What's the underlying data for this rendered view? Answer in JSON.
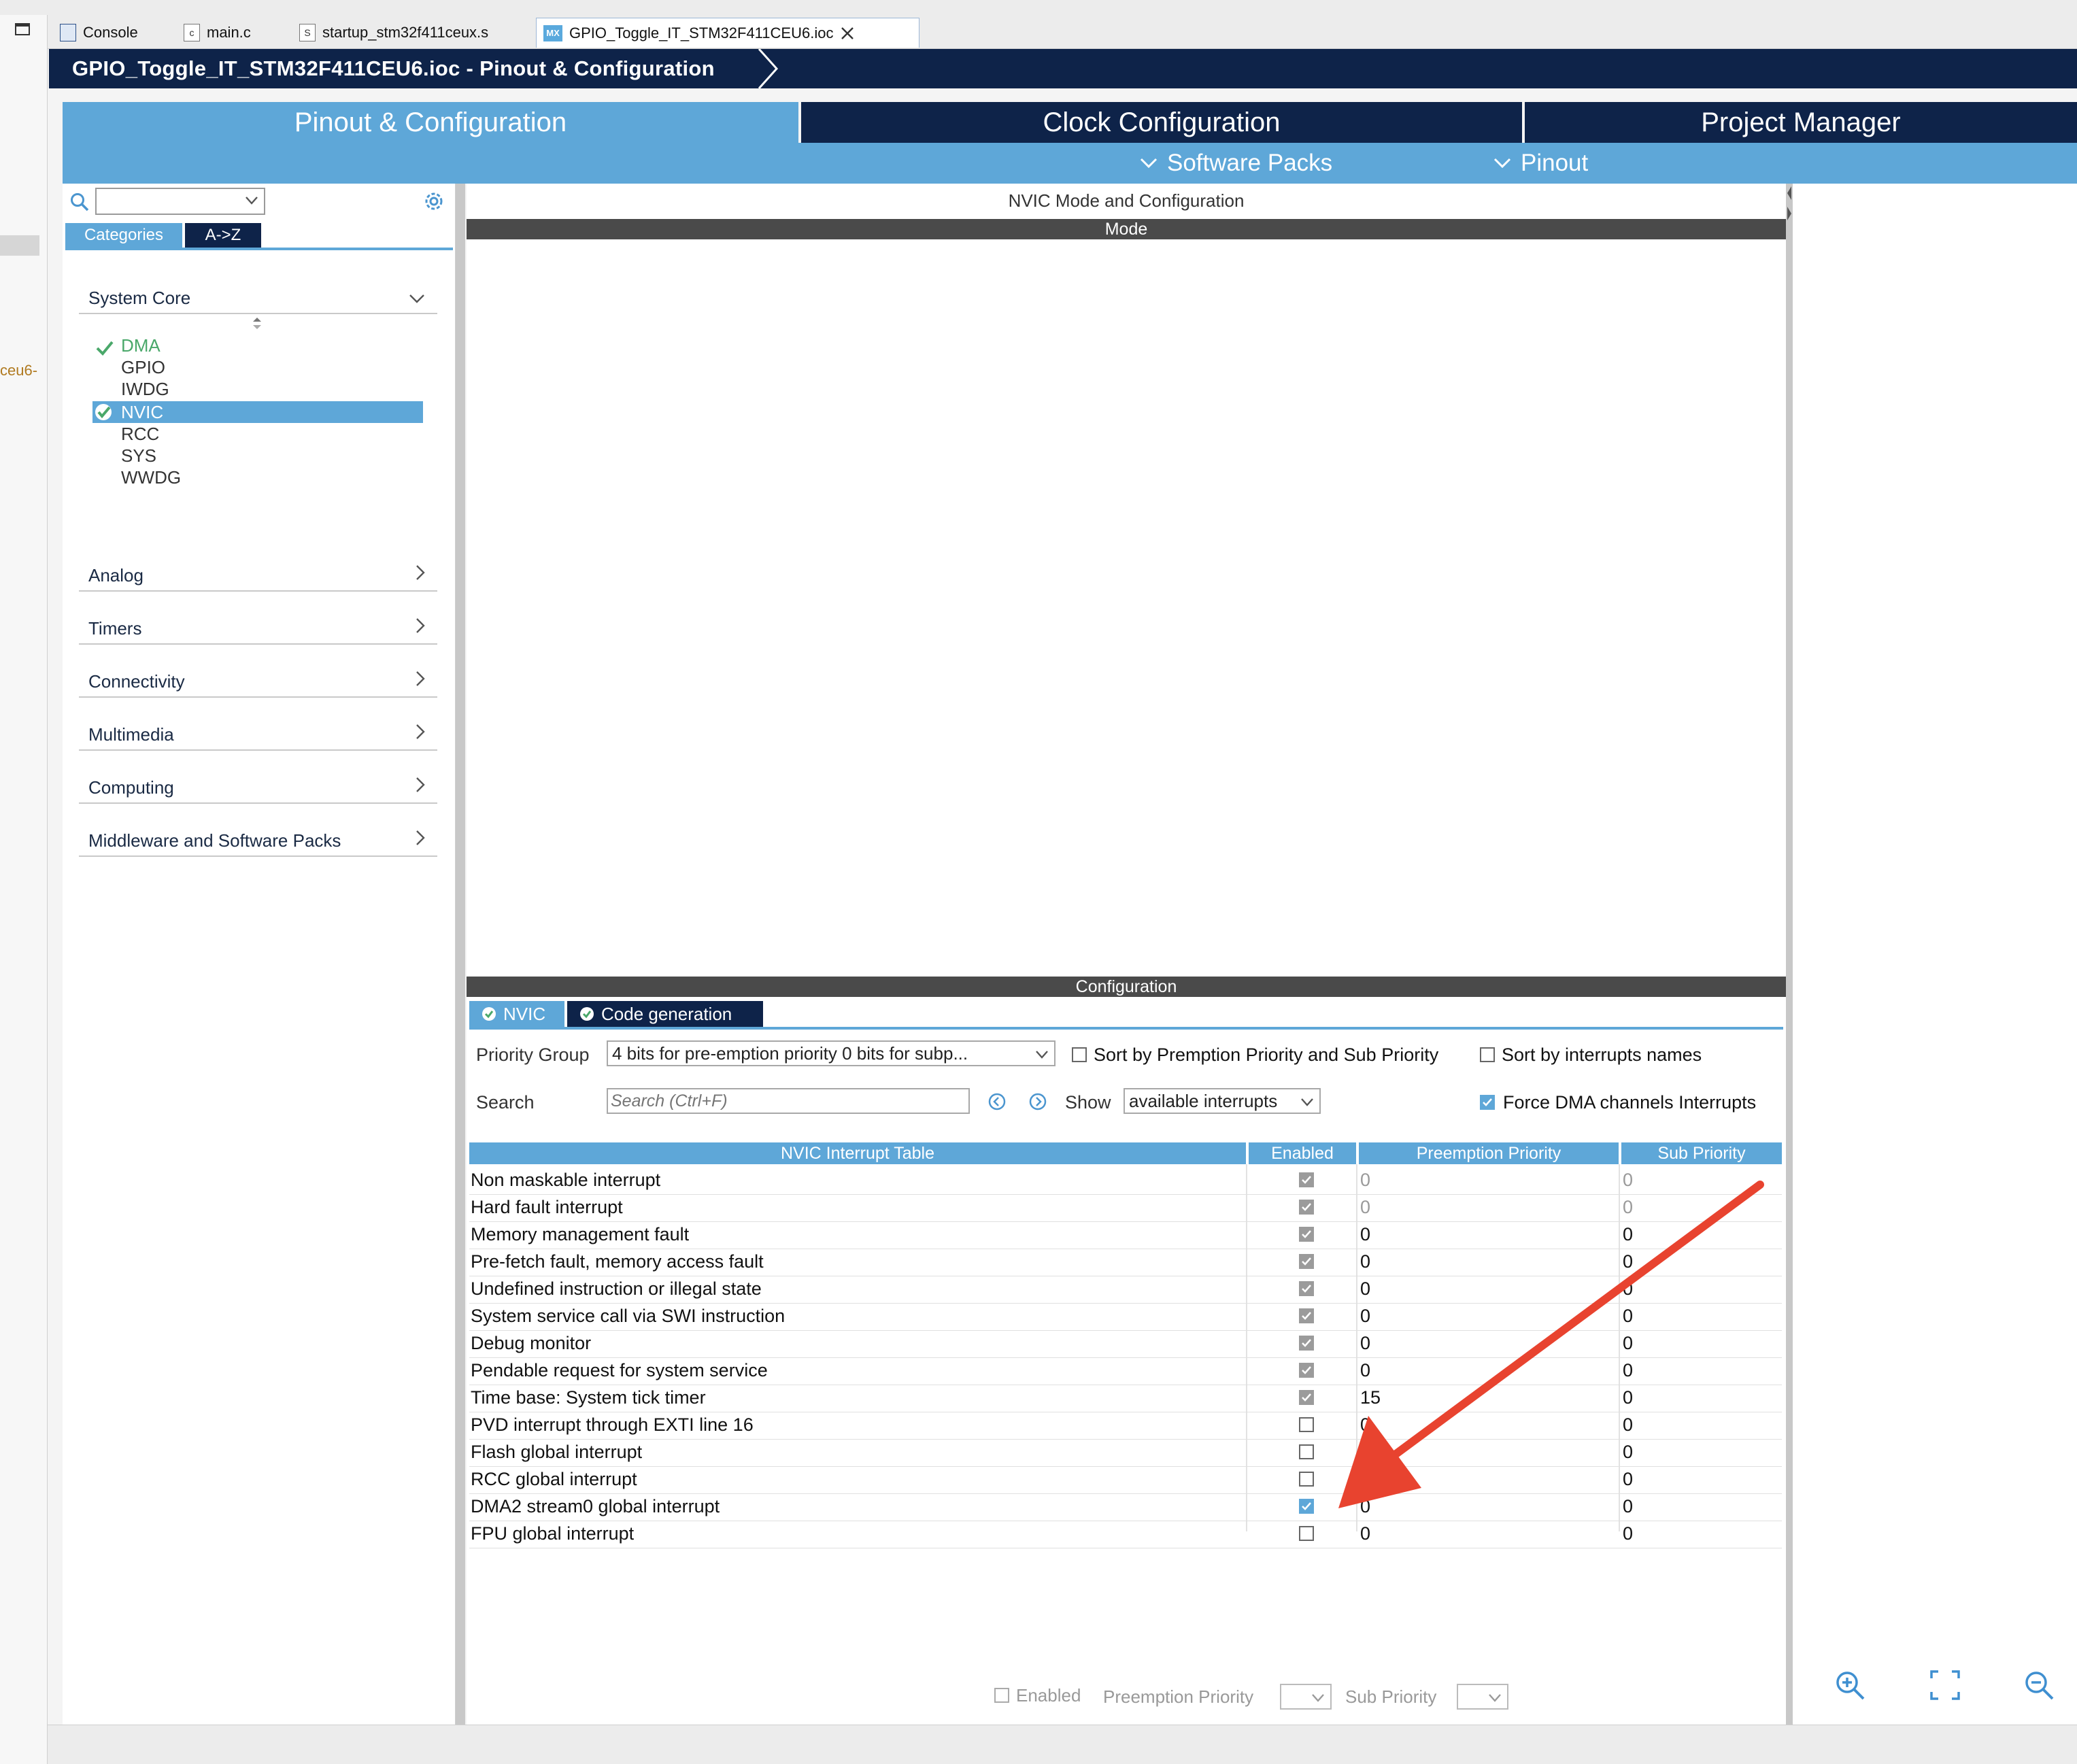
{
  "editor_tabs": [
    {
      "label": "Console",
      "icon": "console-icon"
    },
    {
      "label": "main.c",
      "icon": "c-file-icon",
      "icon_text": "c"
    },
    {
      "label": "startup_stm32f411ceux.s",
      "icon": "asm-file-icon",
      "icon_text": "S"
    },
    {
      "label": "GPIO_Toggle_IT_STM32F411CEU6.ioc",
      "icon": "mx-file-icon",
      "icon_text": "MX"
    }
  ],
  "left_margin_fragment": "ceu6-",
  "title": "GPIO_Toggle_IT_STM32F411CEU6.ioc - Pinout & Configuration",
  "main_tabs": [
    {
      "label": "Pinout & Configuration"
    },
    {
      "label": "Clock Configuration"
    },
    {
      "label": "Project Manager"
    }
  ],
  "sub_menu": [
    {
      "label": "Software Packs"
    },
    {
      "label": "Pinout"
    }
  ],
  "left_panel": {
    "search_value": "",
    "view_tabs": [
      "Categories",
      "A->Z"
    ],
    "categories": [
      {
        "label": "System Core",
        "expanded": true
      },
      {
        "label": "Analog"
      },
      {
        "label": "Timers"
      },
      {
        "label": "Connectivity"
      },
      {
        "label": "Multimedia"
      },
      {
        "label": "Computing"
      },
      {
        "label": "Middleware and Software Packs"
      }
    ],
    "system_core_items": [
      "DMA",
      "GPIO",
      "IWDG",
      "NVIC",
      "RCC",
      "SYS",
      "WWDG"
    ],
    "selected_item": "NVIC"
  },
  "center": {
    "header": "NVIC Mode and Configuration",
    "mode_label": "Mode",
    "config_label": "Configuration",
    "config_tabs": [
      "NVIC",
      "Code generation"
    ],
    "priority_group_label": "Priority Group",
    "priority_group_value": "4 bits for pre-emption priority 0 bits for subp...",
    "sort_premption_label": "Sort by Premption Priority and Sub Priority",
    "sort_names_label": "Sort by interrupts names",
    "search_label": "Search",
    "search_placeholder": "Search (Ctrl+F)",
    "show_label": "Show",
    "show_value": "available interrupts",
    "force_dma_label": "Force DMA channels Interrupts",
    "table_headers": [
      "NVIC Interrupt Table",
      "Enabled",
      "Preemption Priority",
      "Sub Priority"
    ],
    "rows": [
      {
        "name": "Non maskable interrupt",
        "enabled": "locked",
        "preemption": "0",
        "sub": "0",
        "dim": true
      },
      {
        "name": "Hard fault interrupt",
        "enabled": "locked",
        "preemption": "0",
        "sub": "0",
        "dim": true
      },
      {
        "name": "Memory management fault",
        "enabled": "locked",
        "preemption": "0",
        "sub": "0"
      },
      {
        "name": "Pre-fetch fault, memory access fault",
        "enabled": "locked",
        "preemption": "0",
        "sub": "0"
      },
      {
        "name": "Undefined instruction or illegal state",
        "enabled": "locked",
        "preemption": "0",
        "sub": "0"
      },
      {
        "name": "System service call via SWI instruction",
        "enabled": "locked",
        "preemption": "0",
        "sub": "0"
      },
      {
        "name": "Debug monitor",
        "enabled": "locked",
        "preemption": "0",
        "sub": "0"
      },
      {
        "name": "Pendable request for system service",
        "enabled": "locked",
        "preemption": "0",
        "sub": "0"
      },
      {
        "name": "Time base: System tick timer",
        "enabled": "locked",
        "preemption": "15",
        "sub": "0"
      },
      {
        "name": "PVD interrupt through EXTI line 16",
        "enabled": "off",
        "preemption": "0",
        "sub": "0"
      },
      {
        "name": "Flash global interrupt",
        "enabled": "off",
        "preemption": "0",
        "sub": "0"
      },
      {
        "name": "RCC global interrupt",
        "enabled": "off",
        "preemption": "0",
        "sub": "0"
      },
      {
        "name": "DMA2 stream0 global interrupt",
        "enabled": "on",
        "preemption": "0",
        "sub": "0"
      },
      {
        "name": "FPU global interrupt",
        "enabled": "off",
        "preemption": "0",
        "sub": "0"
      }
    ],
    "footer_enabled_label": "Enabled",
    "footer_preemption_label": "Preemption Priority",
    "footer_sub_label": "Sub Priority"
  },
  "colors": {
    "navy": "#0e2349",
    "accent_blue": "#5ea7d8",
    "check_green": "#4aa86a",
    "annotation_red": "#e8432f"
  }
}
